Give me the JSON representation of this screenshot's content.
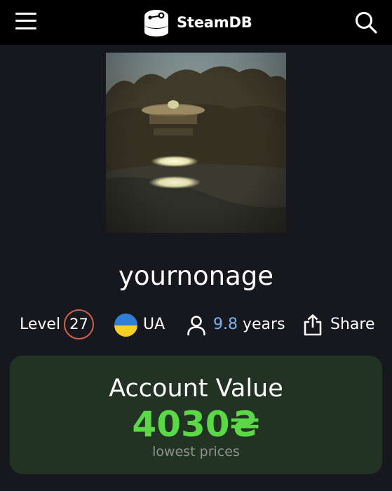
{
  "header": {
    "logo_text": "SteamDB",
    "menu_icon": "hamburger-menu-icon",
    "search_icon": "search-icon"
  },
  "profile": {
    "username": "yournonage",
    "level_label": "Level",
    "level": "27",
    "country_code": "UA",
    "account_age_number": "9.8",
    "account_age_unit": "years",
    "share_label": "Share"
  },
  "account_value": {
    "title": "Account Value",
    "amount": "4030₴",
    "note": "lowest prices"
  },
  "colors": {
    "background": "#16181d",
    "header": "#000000",
    "level_ring": "#d2614b",
    "years_accent": "#78b4ec",
    "card_background": "#223223",
    "value_green": "#5bd845",
    "flag_blue": "#2f7fd6",
    "flag_yellow": "#f6cf22"
  }
}
